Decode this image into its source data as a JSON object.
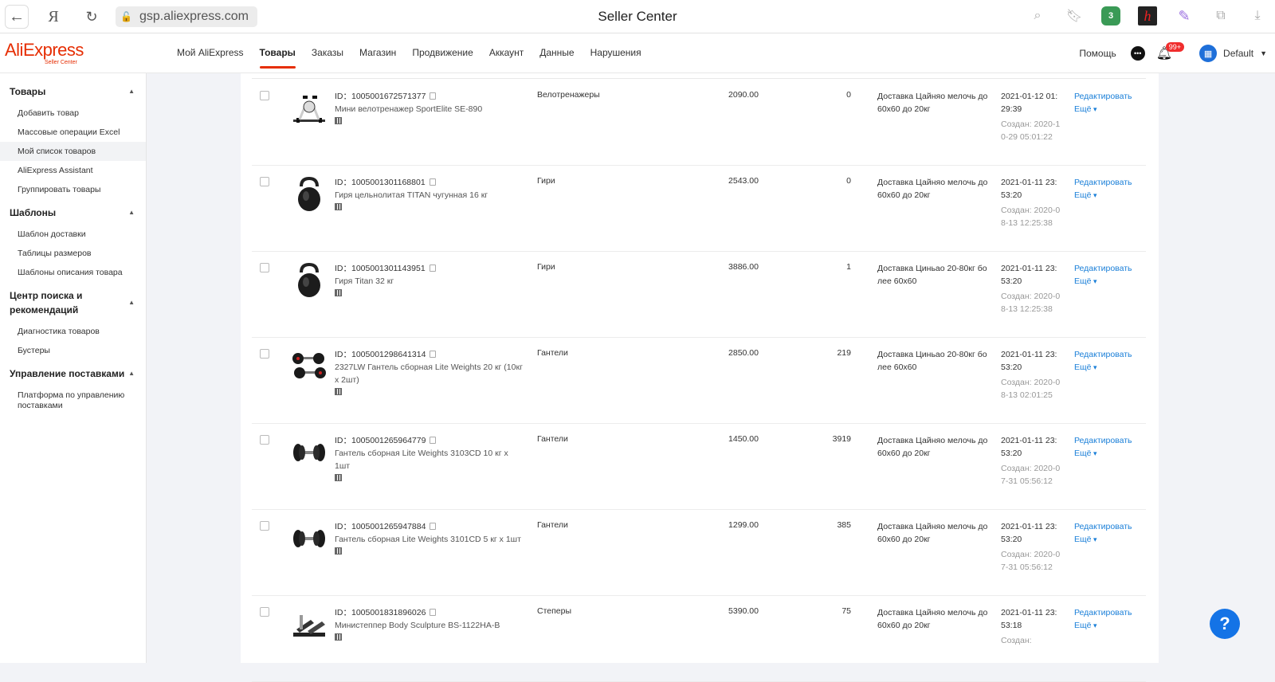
{
  "browser": {
    "url": "gsp.aliexpress.com",
    "title": "Seller Center",
    "ya_label": "Я",
    "ext_badge": "3",
    "ext_h": "h"
  },
  "header": {
    "brand": "AliExpress",
    "brand_sub": "Seller Center",
    "nav": [
      "Мой AliExpress",
      "Товары",
      "Заказы",
      "Магазин",
      "Продвижение",
      "Аккаунт",
      "Данные",
      "Нарушения"
    ],
    "active_nav": "Товары",
    "help": "Помощь",
    "notif_badge": "99+",
    "user": "Default"
  },
  "sidebar": {
    "sections": [
      {
        "title": "Товары",
        "items": [
          "Добавить товар",
          "Массовые операции Excel",
          "Мой список товаров",
          "AliExpress Assistant",
          "Группировать товары"
        ]
      },
      {
        "title": "Шаблоны",
        "items": [
          "Шаблон доставки",
          "Таблицы размеров",
          "Шаблоны описания товара"
        ]
      },
      {
        "title": "Центр поиска и рекомендаций",
        "items": [
          "Диагностика товаров",
          "Бустеры"
        ]
      },
      {
        "title": "Управление поставками",
        "items": [
          "Платформа по управлению поставками"
        ]
      }
    ],
    "active_item": "Мой список товаров"
  },
  "products": [
    {
      "id": "ID：1005001672571377",
      "name": "Мини велотренажер SportElite SE-890",
      "category": "Велотренажеры",
      "price": "2090.00",
      "stock": "0",
      "shipping": "Доставка Цайняо мелочь до 60x60 до 20кг",
      "updated": "2021-01-12 01:29:39",
      "created_label": "Создан:",
      "created": "2020-10-29 05:01:22",
      "edit": "Редактировать",
      "more": "Ещё",
      "img": "bike"
    },
    {
      "id": "ID：1005001301168801",
      "name": "Гиря цельнолитая TITAN чугунная 16 кг",
      "category": "Гири",
      "price": "2543.00",
      "stock": "0",
      "shipping": "Доставка Цайняо мелочь до 60x60 до 20кг",
      "updated": "2021-01-11 23:53:20",
      "created_label": "Создан:",
      "created": "2020-08-13 12:25:38",
      "edit": "Редактировать",
      "more": "Ещё",
      "img": "kettle"
    },
    {
      "id": "ID：1005001301143951",
      "name": "Гиря Titan 32 кг",
      "category": "Гири",
      "price": "3886.00",
      "stock": "1",
      "shipping": "Доставка Циньао 20-80кг более 60x60",
      "updated": "2021-01-11 23:53:20",
      "created_label": "Создан:",
      "created": "2020-08-13 12:25:38",
      "edit": "Редактировать",
      "more": "Ещё",
      "img": "kettle"
    },
    {
      "id": "ID：1005001298641314",
      "name": "2327LW Гантель сборная Lite Weights 20 кг (10кг x 2шт)",
      "category": "Гантели",
      "price": "2850.00",
      "stock": "219",
      "shipping": "Доставка Циньао 20-80кг более 60x60",
      "updated": "2021-01-11 23:53:20",
      "created_label": "Создан:",
      "created": "2020-08-13 02:01:25",
      "edit": "Редактировать",
      "more": "Ещё",
      "img": "dumbbells"
    },
    {
      "id": "ID：1005001265964779",
      "name": "Гантель сборная Lite Weights 3103CD 10 кг x 1шт",
      "category": "Гантели",
      "price": "1450.00",
      "stock": "3919",
      "shipping": "Доставка Цайняо мелочь до 60x60 до 20кг",
      "updated": "2021-01-11 23:53:20",
      "created_label": "Создан:",
      "created": "2020-07-31 05:56:12",
      "edit": "Редактировать",
      "more": "Ещё",
      "img": "dumbbell"
    },
    {
      "id": "ID：1005001265947884",
      "name": "Гантель сборная Lite Weights 3101CD 5 кг x 1шт",
      "category": "Гантели",
      "price": "1299.00",
      "stock": "385",
      "shipping": "Доставка Цайняо мелочь до 60x60 до 20кг",
      "updated": "2021-01-11 23:53:20",
      "created_label": "Создан:",
      "created": "2020-07-31 05:56:12",
      "edit": "Редактировать",
      "more": "Ещё",
      "img": "dumbbell"
    },
    {
      "id": "ID：1005001831896026",
      "name": "Министеппер Body Sculpture BS-1122HA-B",
      "category": "Степеры",
      "price": "5390.00",
      "stock": "75",
      "shipping": "Доставка Цайняо мелочь до 60x60 до 20кг",
      "updated": "2021-01-11 23:53:18",
      "created_label": "Создан:",
      "created": "",
      "edit": "Редактировать",
      "more": "Ещё",
      "img": "stepper"
    }
  ],
  "fab": "?"
}
